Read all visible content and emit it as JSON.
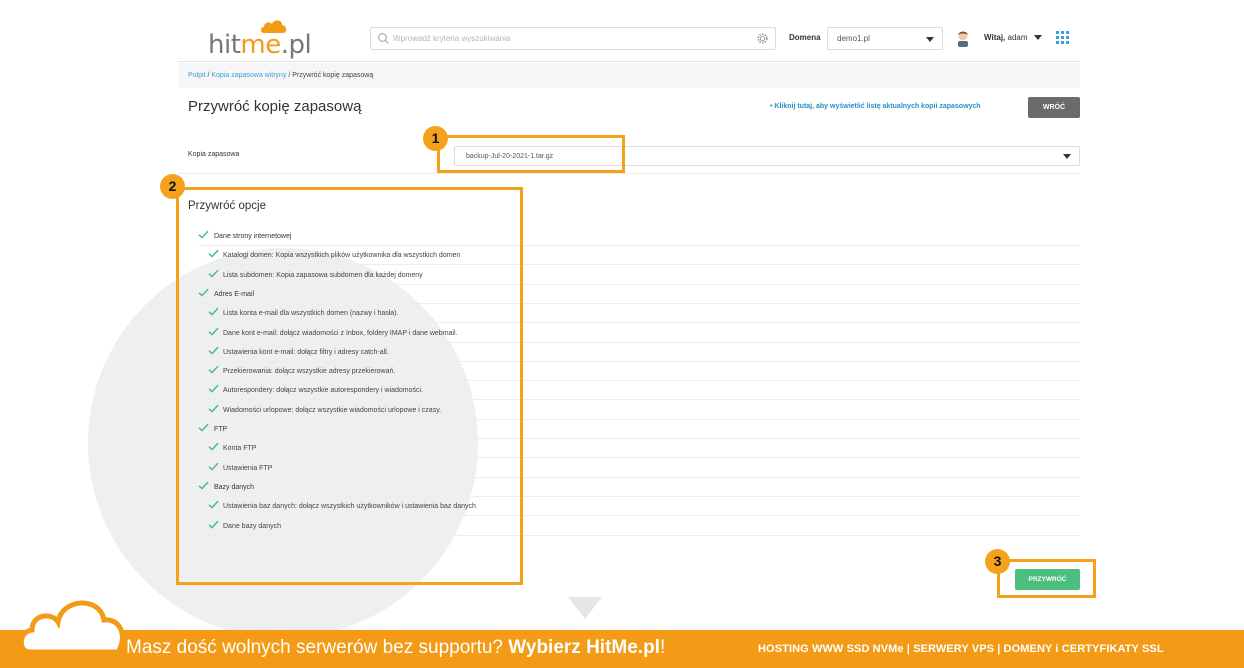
{
  "header": {
    "logo_prefix": "hit",
    "logo_me": "me",
    "logo_suffix": ".pl",
    "search_placeholder": "Wprowadź kryteria wyszukiwania",
    "domain_label": "Domena",
    "domain_value": "demo1.pl",
    "greeting_bold": "Witaj,",
    "greeting_name": " adam"
  },
  "breadcrumb": {
    "items": [
      "Pulpit",
      "Kopia zapasowa witryny",
      "Przywróć kopię zapasową"
    ],
    "separator": " / "
  },
  "page": {
    "title": "Przywróć kopię zapasową",
    "list_link": "• Kliknij tutaj, aby wyświetlić listę aktualnych kopii zapasowych",
    "back_label": "WRÓĆ",
    "backup_label": "Kopia zapasowa",
    "backup_value": "backup-Jul-20-2021-1.tar.gz",
    "options_title": "Przywróć opcje",
    "restore_label": "PRZYWRÓĆ"
  },
  "options": [
    {
      "label": "Dane strony internetowej",
      "level": 1,
      "checked": true
    },
    {
      "label": "Katalogi domen: Kopia wszystkich plików użytkownika dla wszystkich domen",
      "level": 2,
      "checked": true
    },
    {
      "label": "Lista subdomen: Kopia zapasowa subdomen dla każdej domeny",
      "level": 2,
      "checked": true
    },
    {
      "label": "Adres E-mail",
      "level": 1,
      "checked": true
    },
    {
      "label": "Lista konta e-mail dla wszystkich domen (nazwy i hasła).",
      "level": 2,
      "checked": true
    },
    {
      "label": "Dane kont e-mail: dołącz wiadomości z Inbox, foldery IMAP i dane webmail.",
      "level": 2,
      "checked": true
    },
    {
      "label": "Ustawienia kont e-mail: dołącz filtry i adresy catch-all.",
      "level": 2,
      "checked": true
    },
    {
      "label": "Przekierowania: dołącz wszystkie adresy przekierowań.",
      "level": 2,
      "checked": true
    },
    {
      "label": "Autorespondery: dołącz wszystkie autorespondery i wiadomości.",
      "level": 2,
      "checked": true
    },
    {
      "label": "Wiadomości urlopowe: dołącz wszystkie wiadomości urlopowe i czasy.",
      "level": 2,
      "checked": true
    },
    {
      "label": "FTP",
      "level": 1,
      "checked": true
    },
    {
      "label": "Konta FTP",
      "level": 2,
      "checked": true
    },
    {
      "label": "Ustawienia FTP",
      "level": 2,
      "checked": true
    },
    {
      "label": "Bazy danych",
      "level": 1,
      "checked": true
    },
    {
      "label": "Ustawienia baz danych: dołącz wszystkich użytkowników i ustawienia baz danych",
      "level": 2,
      "checked": true
    },
    {
      "label": "Dane bazy danych",
      "level": 2,
      "checked": true
    }
  ],
  "annotations": {
    "badge_1": "1",
    "badge_2": "2",
    "badge_3": "3"
  },
  "footer": {
    "promo_text": "Masz dość wolnych serwerów bez supportu? ",
    "promo_brand": "Wybierz HitMe.pl",
    "promo_end": "!",
    "services": "HOSTING WWW SSD NVMe | SERWERY VPS | DOMENY i CERTYFIKATY SSL"
  },
  "colors": {
    "accent_orange": "#f39a16",
    "highlight_orange": "#f4a11c",
    "link_blue": "#2a8fc9",
    "check_green": "#4cbf7e",
    "back_button_gray": "#6b6b6b"
  },
  "icons": {
    "search": "search-icon",
    "settings": "gear-icon",
    "dropdown": "chevron-down-icon",
    "user": "avatar-icon",
    "apps": "apps-grid-icon",
    "check": "check-icon",
    "cloud": "cloud-icon"
  }
}
